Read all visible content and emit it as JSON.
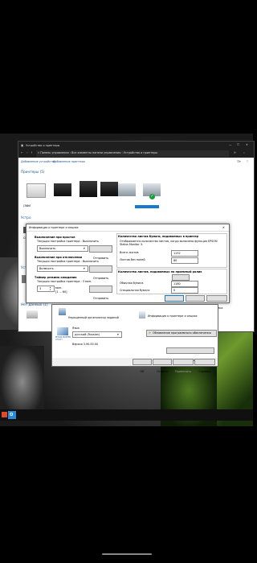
{
  "explorer": {
    "title": "Устройства и принтеры",
    "breadcrumb": "« Панель управления › Все элементы панели управления › Устройства и принтеры",
    "toolbar": {
      "add_device": "Добавление устройства",
      "add_printer": "Добавление принтера"
    },
    "sections": {
      "printers": "Принтеры (5)",
      "devices": "Устро",
      "multimedia": "Устр",
      "no_data": "Нет данных (1)"
    },
    "device_label": "CSR",
    "printer_first_label": "(ЗФИ"
  },
  "options_dialog": {
    "title": "Информация о принтере и опциях",
    "power_off_idle": {
      "header": "Выключение при простое",
      "current": "Текущая настройка принтера : Выключить",
      "value": "Выключить",
      "button": "Отправить"
    },
    "power_off_disconnect": {
      "header": "Выключение при отключении",
      "current": "Текущая настройка принтера : Выключить",
      "value": "Включить",
      "button": "Отправить"
    },
    "sleep_timer": {
      "header": "Таймер режима ожидания",
      "current": "Текущая настройка принтера : 3 мин.",
      "value": "3",
      "unit": "мин.",
      "range": "[1 ... 60]",
      "button": "Отправить"
    },
    "sheets_counter": {
      "header": "Количество листов бумаги, подаваемых в принтер",
      "description": "Отображается количество листов, когда включена функция EPSON Status Monitor 3.",
      "total_label": "Всего листов",
      "total_value": "1152",
      "borderless_label": "Листов без полей",
      "borderless_value": "60"
    },
    "roll_counter": {
      "header": "Количество листов, подаваемых на приемный ролик",
      "reset": "Сброс",
      "plain_label": "Обычная бумага",
      "plain_value": "1180",
      "special_label": "Специальная бумага",
      "special_value": "0"
    },
    "buttons": {
      "ok": "OK",
      "cancel": "Отмена",
      "help": "Справка"
    }
  },
  "utility_dialog": {
    "item_manager": "Упрощенный организатор заданий",
    "item_info": "Информация о принтере и опциях",
    "language_label": "Язык",
    "language_value": "русский (Russian)",
    "software_update": "Обновление программного обеспечения",
    "version": "Версия 3.90.00.00",
    "tech_support": "Техническая поддержка",
    "logo_text": "EPSON PRINTER UTILITY",
    "buttons": {
      "ok": "OK",
      "cancel": "Отмена",
      "apply": "Применить",
      "help": "Справка"
    }
  },
  "taskbar": {
    "app_icon": "outlook-icon"
  },
  "colors": {
    "accent": "#1778d2",
    "dark_chrome": "#1f1f1f",
    "link": "#1e5aa0"
  }
}
